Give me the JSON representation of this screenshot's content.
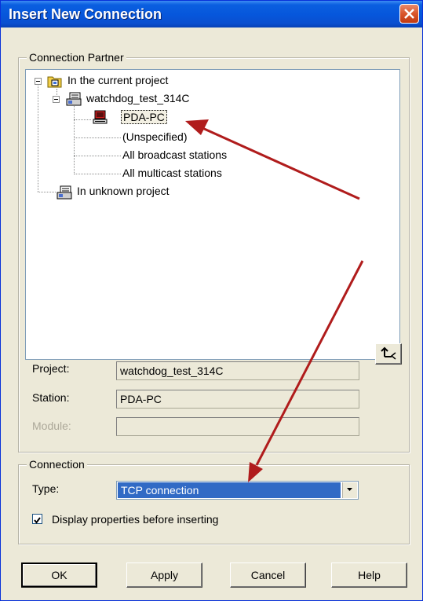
{
  "window": {
    "title": "Insert New Connection"
  },
  "partner": {
    "legend": "Connection Partner",
    "tree": {
      "current_project": "In the current project",
      "project_name": "watchdog_test_314C",
      "station": "PDA-PC",
      "unspecified": "(Unspecified)",
      "broadcast": "All broadcast stations",
      "multicast": "All multicast stations",
      "unknown_project": "In unknown project"
    },
    "fields": {
      "project_label": "Project:",
      "project_value": "watchdog_test_314C",
      "station_label": "Station:",
      "station_value": "PDA-PC",
      "module_label": "Module:",
      "module_value": ""
    }
  },
  "connection": {
    "legend": "Connection",
    "type_label": "Type:",
    "type_value": "TCP connection",
    "checkbox_label": "Display properties before inserting",
    "checkbox_checked": true
  },
  "buttons": {
    "ok": "OK",
    "apply": "Apply",
    "cancel": "Cancel",
    "help": "Help"
  },
  "colors": {
    "titlebar": "#0a5fe0",
    "selection": "#316ac5",
    "annotation_arrow": "#b01c1c"
  }
}
